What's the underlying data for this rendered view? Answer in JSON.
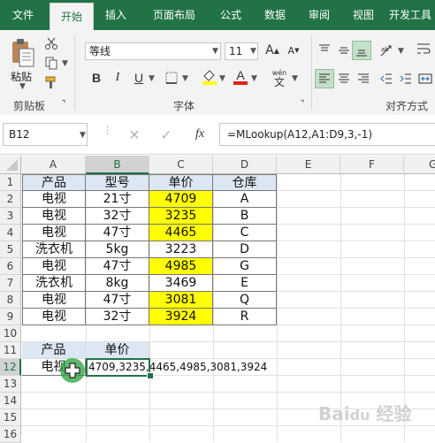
{
  "tabs": [
    "文件",
    "开始",
    "插入",
    "页面布局",
    "公式",
    "数据",
    "审阅",
    "视图",
    "开发工具"
  ],
  "ribbon": {
    "paste_label": "粘贴",
    "font_name": "等线",
    "font_size": "11",
    "group_clipboard": "剪贴板",
    "group_font": "字体",
    "group_align": "对齐方式",
    "bold": "B",
    "italic": "I",
    "underline": "U",
    "wen_label": "wén",
    "wen_char": "文"
  },
  "formula_bar": {
    "name_box": "B12",
    "fx": "fx",
    "formula": "=MLookup(A12,A1:D9,3,-1)"
  },
  "columns": [
    "A",
    "B",
    "C",
    "D",
    "E",
    "F",
    "G"
  ],
  "rows": [
    "1",
    "2",
    "3",
    "4",
    "5",
    "6",
    "7",
    "8",
    "9",
    "10",
    "11",
    "12",
    "13",
    "14",
    "15",
    "16"
  ],
  "table": {
    "headers": [
      "产品",
      "型号",
      "单价",
      "仓库"
    ],
    "rows": [
      [
        "电视",
        "21寸",
        "4709",
        "A"
      ],
      [
        "电视",
        "32寸",
        "3235",
        "B"
      ],
      [
        "电视",
        "47寸",
        "4465",
        "C"
      ],
      [
        "洗衣机",
        "5kg",
        "3223",
        "D"
      ],
      [
        "电视",
        "47寸",
        "4985",
        "G"
      ],
      [
        "洗衣机",
        "8kg",
        "3469",
        "E"
      ],
      [
        "电视",
        "47寸",
        "3081",
        "Q"
      ],
      [
        "电视",
        "32寸",
        "3924",
        "R"
      ]
    ]
  },
  "lookup": {
    "header_product": "产品",
    "header_price": "单价",
    "product": "电视",
    "result": "4709,3235,4465,4985,3081,3924"
  },
  "colors": {
    "accent": "#217346",
    "highlight": "#ffff00",
    "header_fill": "#dde7f3"
  }
}
